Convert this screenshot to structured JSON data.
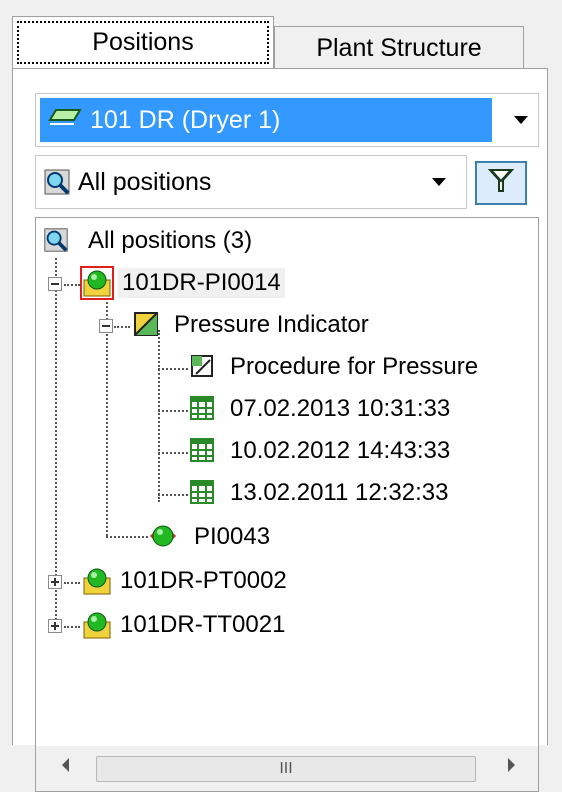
{
  "tabs": [
    {
      "label": "Positions",
      "active": true
    },
    {
      "label": "Plant Structure",
      "active": false
    }
  ],
  "plant_selector": {
    "value": "101 DR (Dryer 1)",
    "icon": "plant-unit-icon"
  },
  "filter_selector": {
    "value": "All positions",
    "icon": "magnifier-icon"
  },
  "filter_button": {
    "icon": "funnel-icon"
  },
  "tree": {
    "root": {
      "label": "All positions (3)",
      "icon": "magnifier-icon"
    },
    "pos1": {
      "label": "101DR-PI0014",
      "icon": "position-icon"
    },
    "type1": {
      "label": "Pressure Indicator",
      "icon": "device-type-icon"
    },
    "proc1": {
      "label": "Procedure for Pressure",
      "icon": "procedure-icon"
    },
    "rec1": {
      "label": "07.02.2013 10:31:33",
      "icon": "record-icon"
    },
    "rec2": {
      "label": "10.02.2012 14:43:33",
      "icon": "record-icon"
    },
    "rec3": {
      "label": "13.02.2011 12:32:33",
      "icon": "record-icon"
    },
    "tag1": {
      "label": "PI0043",
      "icon": "tag-icon"
    },
    "pos2": {
      "label": "101DR-PT0002",
      "icon": "position-icon"
    },
    "pos3": {
      "label": "101DR-TT0021",
      "icon": "position-icon"
    }
  },
  "scrollbar": {
    "grip": "III"
  },
  "colors": {
    "selection": "#3399ff",
    "accent": "#3c7fb1"
  }
}
